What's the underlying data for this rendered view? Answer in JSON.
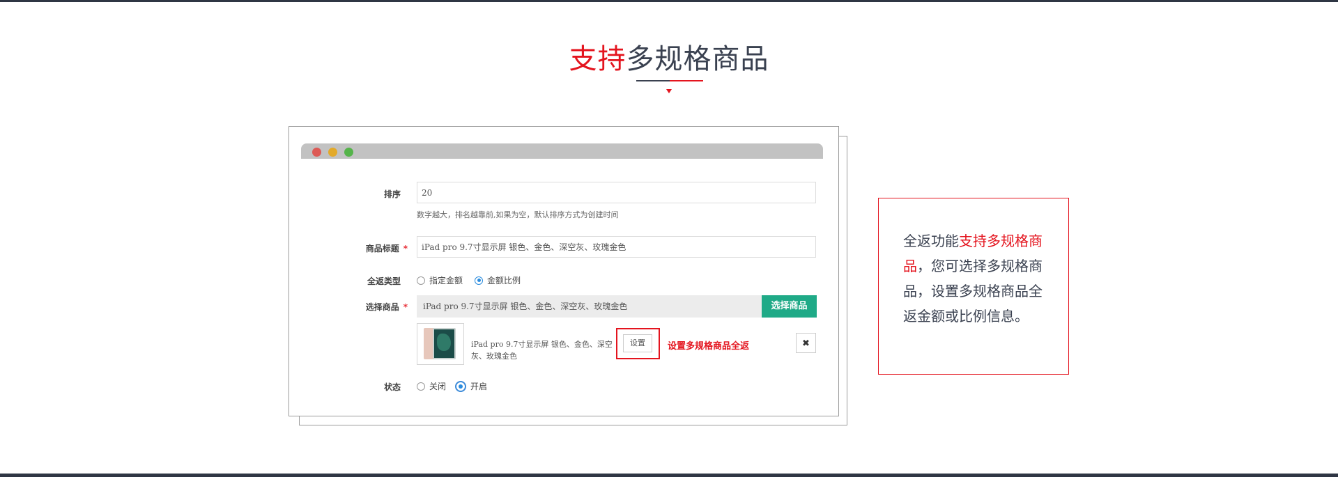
{
  "heading": {
    "highlight": "支持",
    "rest": "多规格商品"
  },
  "form": {
    "sort": {
      "label": "排序",
      "value": "20",
      "help": "数字越大，排名越靠前,如果为空，默认排序方式为创建时间"
    },
    "title": {
      "label": "商品标题",
      "required_mark": "*",
      "value": "iPad pro 9.7寸显示屏 银色、金色、深空灰、玫瑰金色"
    },
    "rebate_type": {
      "label": "全返类型",
      "options": [
        "指定金额",
        "金额比例"
      ],
      "selected": "金额比例"
    },
    "select_product": {
      "label": "选择商品",
      "required_mark": "*",
      "value": "iPad pro 9.7寸显示屏 银色、金色、深空灰、玫瑰金色",
      "button": "选择商品"
    },
    "product_item": {
      "name": "iPad pro 9.7寸显示屏 银色、金色、深空灰、玫瑰金色",
      "set_button": "设置",
      "note": "设置多规格商品全返",
      "remove_icon": "close-icon"
    },
    "status": {
      "label": "状态",
      "options": [
        "关闭",
        "开启"
      ],
      "selected": "开启"
    }
  },
  "info_box": {
    "part1": "全返功能",
    "highlight": "支持多规格商品",
    "part2": "，您可选择多规格商品，设置多规格商品全返金额或比例信息。"
  },
  "colors": {
    "accent": "#e4141e",
    "primary_button": "#1faa87",
    "heading": "#3a4150"
  }
}
